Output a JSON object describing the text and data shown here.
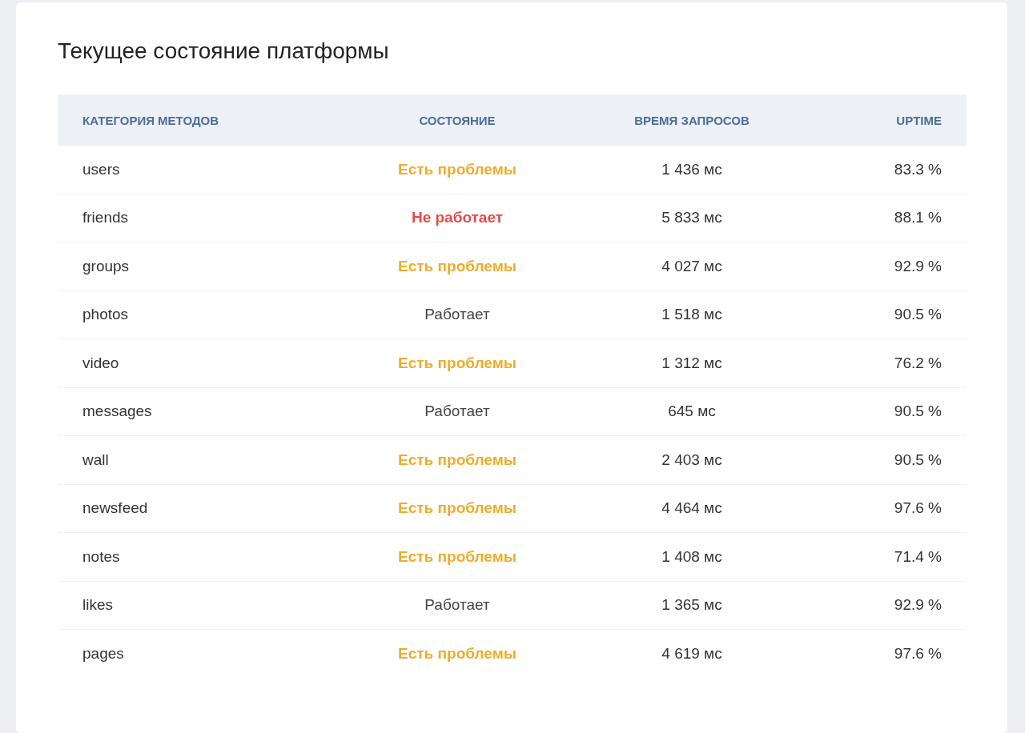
{
  "title": "Текущее состояние платформы",
  "table": {
    "columns": [
      "КАТЕГОРИЯ МЕТОДОВ",
      "СОСТОЯНИЕ",
      "ВРЕМЯ ЗАПРОСОВ",
      "UPTIME"
    ],
    "rows": [
      {
        "category": "users",
        "status": "Есть проблемы",
        "kind": "problems",
        "time": "1 436 мс",
        "uptime": "83.3 %"
      },
      {
        "category": "friends",
        "status": "Не работает",
        "kind": "down",
        "time": "5 833 мс",
        "uptime": "88.1 %"
      },
      {
        "category": "groups",
        "status": "Есть проблемы",
        "kind": "problems",
        "time": "4 027 мс",
        "uptime": "92.9 %"
      },
      {
        "category": "photos",
        "status": "Работает",
        "kind": "ok",
        "time": "1 518 мс",
        "uptime": "90.5 %"
      },
      {
        "category": "video",
        "status": "Есть проблемы",
        "kind": "problems",
        "time": "1 312 мс",
        "uptime": "76.2 %"
      },
      {
        "category": "messages",
        "status": "Работает",
        "kind": "ok",
        "time": "645 мс",
        "uptime": "90.5 %"
      },
      {
        "category": "wall",
        "status": "Есть проблемы",
        "kind": "problems",
        "time": "2 403 мс",
        "uptime": "90.5 %"
      },
      {
        "category": "newsfeed",
        "status": "Есть проблемы",
        "kind": "problems",
        "time": "4 464 мс",
        "uptime": "97.6 %"
      },
      {
        "category": "notes",
        "status": "Есть проблемы",
        "kind": "problems",
        "time": "1 408 мс",
        "uptime": "71.4 %"
      },
      {
        "category": "likes",
        "status": "Работает",
        "kind": "ok",
        "time": "1 365 мс",
        "uptime": "92.9 %"
      },
      {
        "category": "pages",
        "status": "Есть проблемы",
        "kind": "problems",
        "time": "4 619 мс",
        "uptime": "97.6 %"
      }
    ]
  }
}
